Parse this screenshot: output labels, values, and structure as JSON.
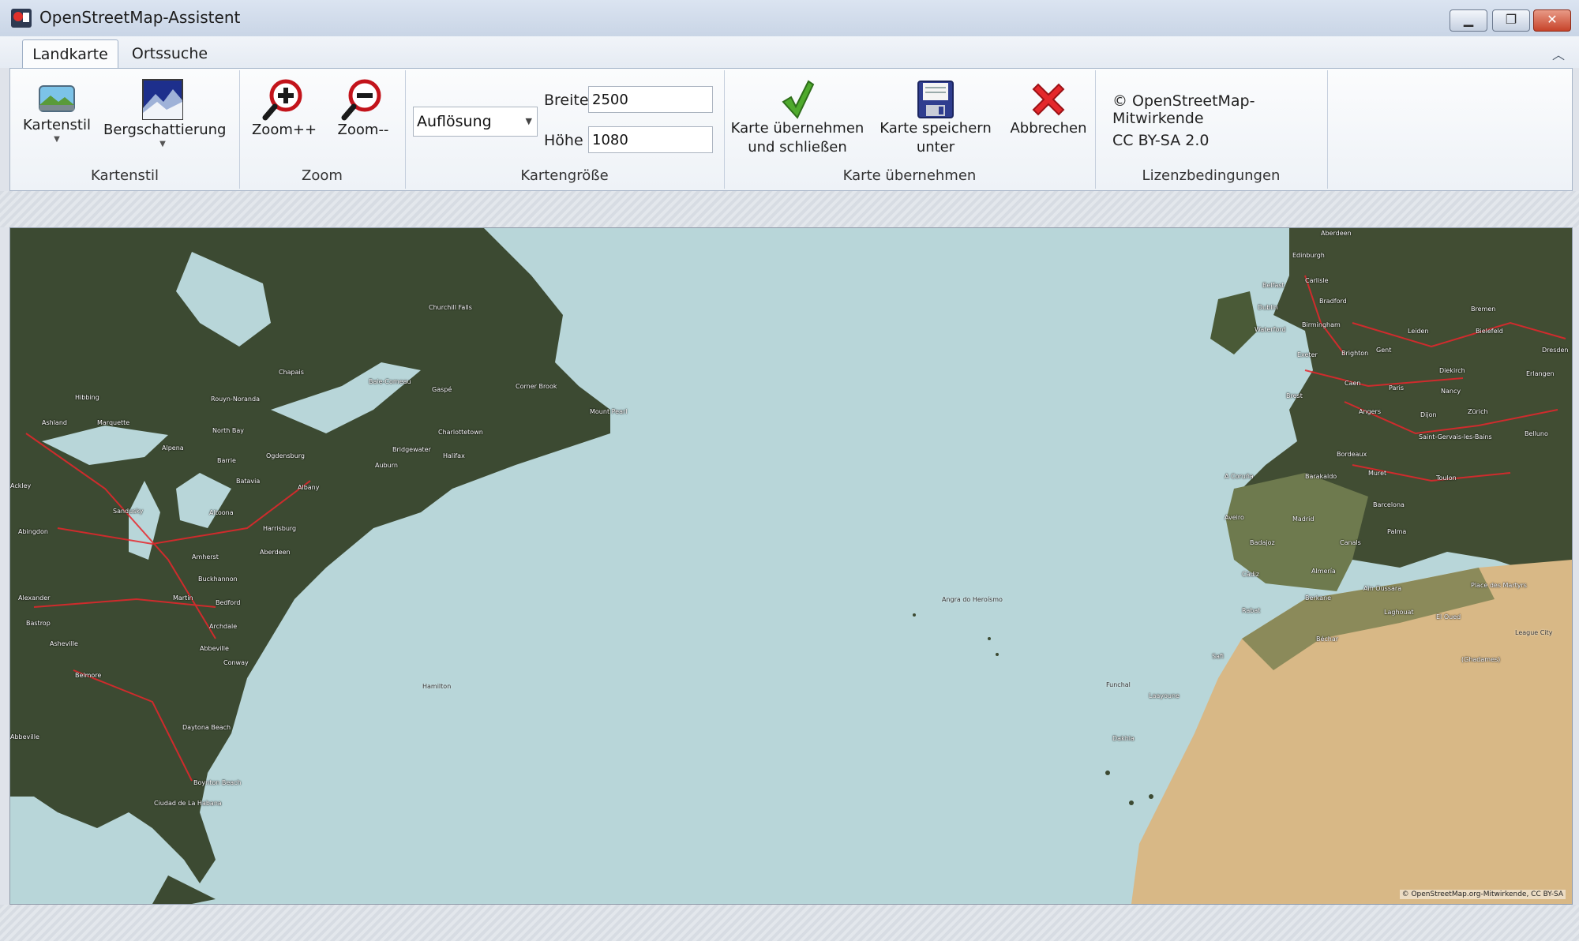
{
  "window": {
    "title": "OpenStreetMap-Assistent"
  },
  "tabs": [
    {
      "label": "Landkarte",
      "active": true
    },
    {
      "label": "Ortssuche",
      "active": false
    }
  ],
  "ribbon": {
    "kartenstil": {
      "group_label": "Kartenstil",
      "style_button": "Kartenstil",
      "hillshade_button": "Bergschattierung"
    },
    "zoom": {
      "group_label": "Zoom",
      "zoom_in": "Zoom++",
      "zoom_out": "Zoom--"
    },
    "size": {
      "group_label": "Kartengröße",
      "resolution_select": "Auflösung",
      "width_label": "Breite",
      "width_value": "2500",
      "height_label": "Höhe",
      "height_value": "1080"
    },
    "apply": {
      "group_label": "Karte übernehmen",
      "apply_close_line1": "Karte übernehmen",
      "apply_close_line2": "und schließen",
      "save_as_line1": "Karte speichern",
      "save_as_line2": "unter",
      "cancel": "Abbrechen"
    },
    "license": {
      "group_label": "Lizenzbedingungen",
      "copyright": "© OpenStreetMap-Mitwirkende",
      "license": "CC BY-SA 2.0"
    }
  },
  "map": {
    "attribution": "© OpenStreetMap.org-Mitwirkende, CC BY-SA",
    "labels": [
      "Churchill Falls",
      "Chapais",
      "Baie-Comeau",
      "Gaspé",
      "Corner Brook",
      "Mount Pearl",
      "Rouyn-Noranda",
      "North Bay",
      "Charlottetown",
      "Halifax",
      "Ogdensburg",
      "Albany",
      "Auburn",
      "Bridgewater",
      "Alpena",
      "Barrie",
      "Batavia",
      "Amherst",
      "Sandusky",
      "Harrisburg",
      "Altoona",
      "Aberdeen",
      "Buckhannon",
      "Bedford",
      "Martin",
      "Archdale",
      "Abbeville",
      "Conway",
      "Belmore",
      "Asheville",
      "Daytona Beach",
      "Boynton Beach",
      "Ciudad de La Habana",
      "Hamilton",
      "Angra do Heroísmo",
      "Funchal",
      "Aberdeen",
      "Edinburgh",
      "Carlisle",
      "Belfast",
      "Dublin",
      "Bradford",
      "Birmingham",
      "Waterford",
      "Exeter",
      "Brighton",
      "Leiden",
      "Bremen",
      "Bielefeld",
      "Gent",
      "Dresden",
      "Diekirch",
      "Caen",
      "Paris",
      "Erlangen",
      "Brest",
      "Nancy",
      "Angers",
      "Dijon",
      "Zürich",
      "Bordeaux",
      "Saint-Gervais-les-Bains",
      "Belluno",
      "Barakaldo",
      "A Coruña",
      "Muret",
      "Toulon",
      "Barcelona",
      "Aveiro",
      "Madrid",
      "Palma",
      "Badajoz",
      "Canals",
      "Cádiz",
      "Almería",
      "Rabat",
      "Berkane",
      "Ain Oussara",
      "Place des Martyrs",
      "Laghouat",
      "El Oued",
      "League City",
      "Béchar",
      "Safi",
      "(Ghadames)",
      "Laayoune",
      "Dakhla",
      "Ackley",
      "Abingdon",
      "Alexander",
      "Bastrop",
      "Abbeville",
      "Ashland",
      "Marquette",
      "Hibbing"
    ]
  },
  "colors": {
    "ocean": "#b8d6d9",
    "road": "#e8262c",
    "land_forest": "#3d4c35",
    "desert": "#d8b886",
    "accent_close": "#c7432a"
  },
  "icons": {
    "kartenstil": "landscape-icon",
    "bergschattierung": "hillshade-icon",
    "zoom_in": "zoom-in-icon",
    "zoom_out": "zoom-out-icon",
    "apply": "checkmark-icon",
    "save": "floppy-disk-icon",
    "cancel": "red-x-icon"
  }
}
